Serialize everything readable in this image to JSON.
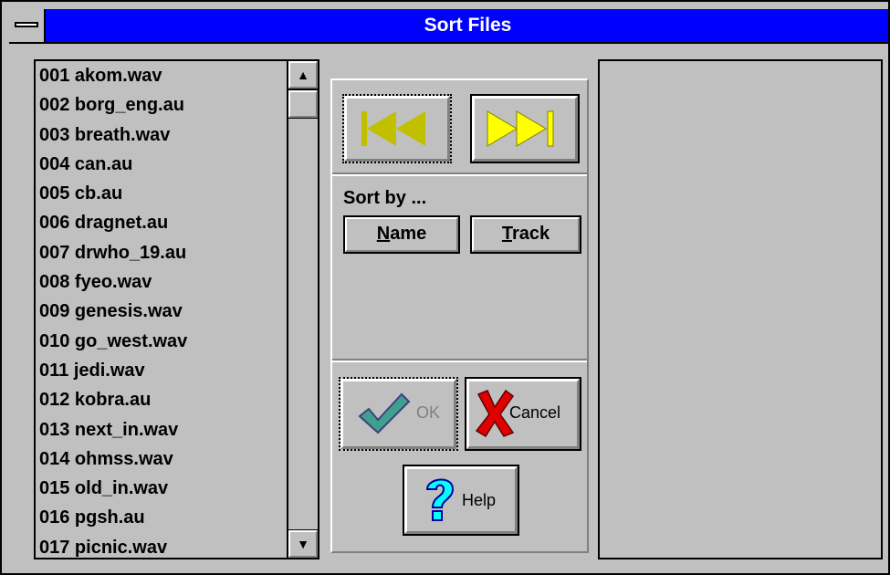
{
  "window": {
    "title": "Sort Files"
  },
  "files": [
    "001 akom.wav",
    "002 borg_eng.au",
    "003 breath.wav",
    "004 can.au",
    "005 cb.au",
    "006 dragnet.au",
    "007 drwho_19.au",
    "008 fyeo.wav",
    "009 genesis.wav",
    "010 go_west.wav",
    "011 jedi.wav",
    "012 kobra.au",
    "013 next_in.wav",
    "014 ohmss.wav",
    "015 old_in.wav",
    "016 pgsh.au",
    "017 picnic.wav"
  ],
  "sort": {
    "label": "Sort by ...",
    "name_button": {
      "mnemonic": "N",
      "rest": "ame"
    },
    "track_button": {
      "mnemonic": "T",
      "rest": "rack"
    }
  },
  "buttons": {
    "ok": "OK",
    "cancel": "Cancel",
    "help": "Help"
  },
  "icons": {
    "system_menu": "system-menu-icon",
    "scroll_up": "arrow-up-icon",
    "scroll_down": "arrow-down-icon",
    "first": "skip-to-start-icon",
    "last": "skip-to-end-icon",
    "ok": "checkmark-icon",
    "cancel": "x-mark-icon",
    "help": "question-mark-icon"
  },
  "colors": {
    "title_bar": "#0000ff",
    "face": "#c0c0c0",
    "nav_active": "#ffff00",
    "nav_disabled": "#c0c000"
  }
}
